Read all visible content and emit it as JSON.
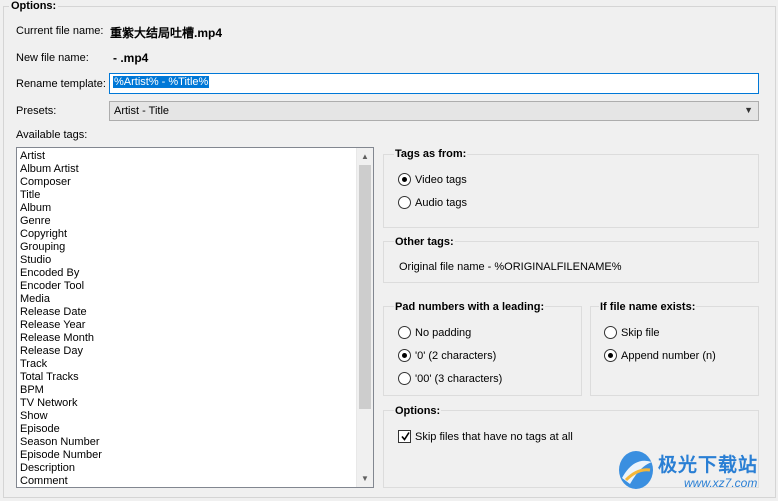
{
  "options": {
    "title": "Options:",
    "current_file_label": "Current file name:",
    "current_file_value": "重紫大结局吐槽.mp4",
    "new_file_label": "New file name:",
    "new_file_value": "- .mp4",
    "rename_label": "Rename template:",
    "rename_value": "%Artist% - %Title%",
    "presets_label": "Presets:",
    "presets_value": "Artist - Title",
    "available_tags_label": "Available tags:"
  },
  "tags": [
    "Artist",
    "Album Artist",
    "Composer",
    "Title",
    "Album",
    "Genre",
    "Copyright",
    "Grouping",
    "Studio",
    "Encoded By",
    "Encoder Tool",
    "Media",
    "Release Date",
    "Release Year",
    "Release Month",
    "Release Day",
    "Track",
    "Total Tracks",
    "BPM",
    "TV Network",
    "Show",
    "Episode",
    "Season Number",
    "Episode Number",
    "Description",
    "Comment"
  ],
  "tags_as_from": {
    "title": "Tags as from:",
    "video": "Video tags",
    "audio": "Audio tags",
    "selected": "video"
  },
  "other_tags": {
    "title": "Other tags:",
    "text": "Original file name - %ORIGINALFILENAME%"
  },
  "pad_numbers": {
    "title": "Pad numbers with a leading:",
    "no_padding": "No padding",
    "two_chars": "'0' (2 characters)",
    "three_chars": "'00' (3 characters)",
    "selected": "two_chars"
  },
  "if_exists": {
    "title": "If file name exists:",
    "skip": "Skip file",
    "append": "Append number (n)",
    "selected": "append"
  },
  "options2": {
    "title": "Options:",
    "skip_no_tags": "Skip files that have no tags at all",
    "skip_no_tags_checked": true
  },
  "watermark": {
    "text": "极光下载站",
    "url": "www.xz7.com"
  },
  "colors": {
    "selection": "#0078d7",
    "watermark": "#2a7fd4"
  }
}
